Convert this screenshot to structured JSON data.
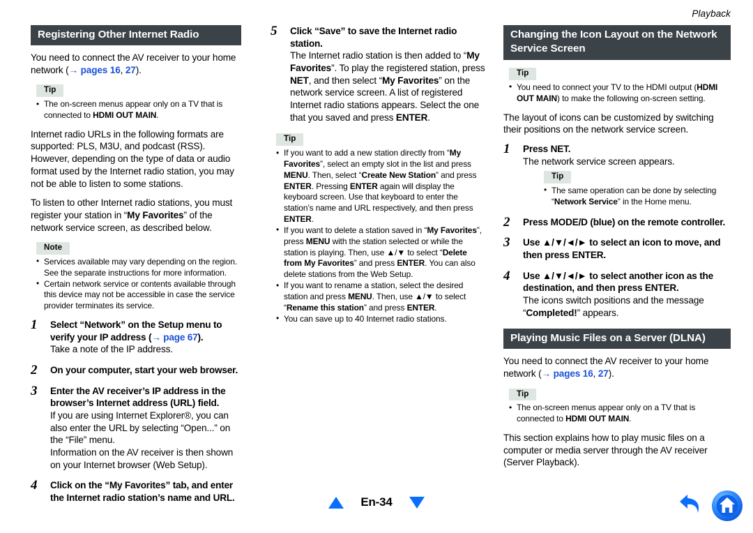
{
  "page": {
    "running_head": "Playback",
    "folio": "En-34",
    "accent_blue": "#0a6efc",
    "link_blue": "#1a51d8",
    "heading_bg": "#3b4348",
    "badge_bg": "#dee6e1"
  },
  "col1": {
    "heading": "Registering Other Internet Radio",
    "intro_a": "You need to connect the AV receiver to your home network (",
    "intro_link_pages": "→ pages 16",
    "intro_comma": ", ",
    "intro_link_27": "27",
    "intro_b": ").",
    "tip_label": "Tip",
    "tip_bullets": [
      {
        "parts": [
          {
            "t": "The on-screen menus appear only on a TV that is connected to ",
            "bold": false
          },
          {
            "t": "HDMI OUT MAIN",
            "bold": true
          },
          {
            "t": ".",
            "bold": false
          }
        ]
      }
    ],
    "para2": "Internet radio URLs in the following formats are supported: PLS, M3U, and podcast (RSS). However, depending on the type of data or audio format used by the Internet radio station, you may not be able to listen to some stations.",
    "para3_a": "To listen to other Internet radio stations, you must register your station in “",
    "para3_bold": "My Favorites",
    "para3_b": "” of the network service screen, as described below.",
    "note_label": "Note",
    "note_bullets": [
      "Services available may vary depending on the region. See the separate instructions for more information.",
      "Certain network service or contents available through this device may not be accessible in case the service provider terminates its service."
    ],
    "steps": [
      {
        "num": "1",
        "title_a": "Select “Network” on the Setup menu to verify your IP address (",
        "title_link": "→ page 67",
        "title_b": ").",
        "body": [
          "Take a note of the IP address."
        ]
      },
      {
        "num": "2",
        "title_a": "On your computer, start your web browser.",
        "title_link": "",
        "title_b": "",
        "body": []
      },
      {
        "num": "3",
        "title_a": "Enter the AV receiver’s IP address in the browser’s Internet address (URL) field.",
        "title_link": "",
        "title_b": "",
        "body": [
          "If you are using Internet Explorer®, you can also enter the URL by selecting “Open...” on the “File” menu.",
          "Information on the AV receiver is then shown on your Internet browser (Web Setup)."
        ]
      },
      {
        "num": "4",
        "title_a": "Click on the “My Favorites” tab, and enter the Internet radio station’s name and URL.",
        "title_link": "",
        "title_b": "",
        "body": []
      }
    ]
  },
  "col2": {
    "step5": {
      "num": "5",
      "title": "Click “Save” to save the Internet radio station.",
      "body_parts": [
        {
          "t": "The Internet radio station is then added to “",
          "bold": false
        },
        {
          "t": "My Favorites",
          "bold": true
        },
        {
          "t": "”. To play the registered station, press ",
          "bold": false
        },
        {
          "t": "NET",
          "bold": true
        },
        {
          "t": ", and then select “",
          "bold": false
        },
        {
          "t": "My Favorites",
          "bold": true
        },
        {
          "t": "” on the network service screen. A list of registered Internet radio stations appears. Select the one that you saved and press ",
          "bold": false
        },
        {
          "t": "ENTER",
          "bold": true
        },
        {
          "t": ".",
          "bold": false
        }
      ]
    },
    "tip_label": "Tip",
    "tip_bullets": [
      {
        "parts": [
          {
            "t": "If you want to add a new station directly from “",
            "bold": false
          },
          {
            "t": "My Favorites",
            "bold": true
          },
          {
            "t": "”, select an empty slot in the list and press ",
            "bold": false
          },
          {
            "t": "MENU",
            "bold": true
          },
          {
            "t": ". Then, select “",
            "bold": false
          },
          {
            "t": "Create New Station",
            "bold": true
          },
          {
            "t": "” and press ",
            "bold": false
          },
          {
            "t": "ENTER",
            "bold": true
          },
          {
            "t": ". Pressing ",
            "bold": false
          },
          {
            "t": "ENTER",
            "bold": true
          },
          {
            "t": " again will display the keyboard screen. Use that keyboard to enter the station’s name and URL respectively, and then press ",
            "bold": false
          },
          {
            "t": "ENTER",
            "bold": true
          },
          {
            "t": ".",
            "bold": false
          }
        ]
      },
      {
        "parts": [
          {
            "t": "If you want to delete a station saved in “",
            "bold": false
          },
          {
            "t": "My Favorites",
            "bold": true
          },
          {
            "t": "”, press ",
            "bold": false
          },
          {
            "t": "MENU",
            "bold": true
          },
          {
            "t": " with the station selected or while the station is playing. Then, use ▲/▼ to select “",
            "bold": false
          },
          {
            "t": "Delete from My Favorites",
            "bold": true
          },
          {
            "t": "” and press ",
            "bold": false
          },
          {
            "t": "ENTER",
            "bold": true
          },
          {
            "t": ". You can also delete stations from the Web Setup.",
            "bold": false
          }
        ]
      },
      {
        "parts": [
          {
            "t": "If you want to rename a station, select the desired station and press ",
            "bold": false
          },
          {
            "t": "MENU",
            "bold": true
          },
          {
            "t": ". Then, use ▲/▼ to select “",
            "bold": false
          },
          {
            "t": "Rename this station",
            "bold": true
          },
          {
            "t": "” and press ",
            "bold": false
          },
          {
            "t": "ENTER",
            "bold": true
          },
          {
            "t": ".",
            "bold": false
          }
        ]
      },
      {
        "parts": [
          {
            "t": "You can save up to 40 Internet radio stations.",
            "bold": false
          }
        ]
      }
    ]
  },
  "col3": {
    "heading": "Changing the Icon Layout on the Network Service Screen",
    "tip_label": "Tip",
    "tip_bullets": [
      {
        "parts": [
          {
            "t": "You need to connect your TV to the HDMI output (",
            "bold": false
          },
          {
            "t": "HDMI OUT MAIN",
            "bold": true
          },
          {
            "t": ") to make the following on-screen setting.",
            "bold": false
          }
        ]
      }
    ],
    "para1": "The layout of icons can be customized by switching their positions on the network service screen.",
    "steps": [
      {
        "num": "1",
        "title": "Press NET.",
        "body": [
          "The network service screen appears."
        ],
        "inner_tip_label": "Tip",
        "inner_tip_bullets": [
          {
            "parts": [
              {
                "t": "The same operation can be done by selecting “",
                "bold": false
              },
              {
                "t": "Network Service",
                "bold": true
              },
              {
                "t": "” in the Home menu.",
                "bold": false
              }
            ]
          }
        ]
      },
      {
        "num": "2",
        "title": "Press MODE/D (blue) on the remote controller.",
        "body": []
      },
      {
        "num": "3",
        "title": "Use ▲/▼/◄/► to select an icon to move, and then press ENTER.",
        "body": []
      },
      {
        "num": "4",
        "title": "Use ▲/▼/◄/► to select another icon as the destination, and then press ENTER.",
        "body_parts": [
          {
            "t": "The icons switch positions and the message “",
            "bold": false
          },
          {
            "t": "Completed!",
            "bold": true
          },
          {
            "t": "” appears.",
            "bold": false
          }
        ]
      }
    ],
    "heading2": "Playing Music Files on a Server (DLNA)",
    "intro_a": "You need to connect the AV receiver to your home network (",
    "intro_link_pages": "→ pages 16",
    "intro_comma": ", ",
    "intro_link_27": "27",
    "intro_b": ").",
    "tip2_label": "Tip",
    "tip2_bullets": [
      {
        "parts": [
          {
            "t": "The on-screen menus appear only on a TV that is connected to ",
            "bold": false
          },
          {
            "t": "HDMI OUT MAIN",
            "bold": true
          },
          {
            "t": ".",
            "bold": false
          }
        ]
      }
    ],
    "para2": "This section explains how to play music files on a computer or media server through the AV receiver (Server Playback)."
  },
  "footer": {
    "folio": "En-34",
    "up_arrow": "triangle-up-icon",
    "down_arrow": "triangle-down-icon",
    "back_icon": "back-arrow-icon",
    "home_icon": "home-icon"
  }
}
